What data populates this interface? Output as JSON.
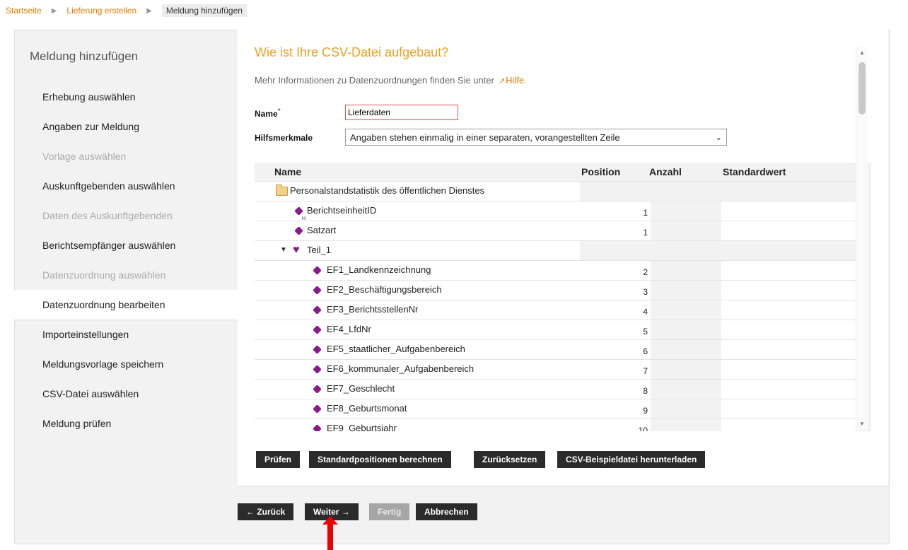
{
  "breadcrumb": {
    "items": [
      "Startseite",
      "Lieferung erstellen"
    ],
    "current": "Meldung hinzufügen"
  },
  "sidebar": {
    "title": "Meldung hinzufügen",
    "steps": [
      {
        "label": "Erhebung auswählen",
        "state": "enabled"
      },
      {
        "label": "Angaben zur Meldung",
        "state": "enabled"
      },
      {
        "label": "Vorlage auswählen",
        "state": "disabled"
      },
      {
        "label": "Auskunftgebenden auswählen",
        "state": "enabled"
      },
      {
        "label": "Daten des Auskunftgebenden",
        "state": "disabled"
      },
      {
        "label": "Berichtsempfänger auswählen",
        "state": "enabled"
      },
      {
        "label": "Datenzuordnung auswählen",
        "state": "disabled"
      },
      {
        "label": "Datenzuordnung bearbeiten",
        "state": "active"
      },
      {
        "label": "Importeinstellungen",
        "state": "enabled"
      },
      {
        "label": "Meldungsvorlage speichern",
        "state": "enabled"
      },
      {
        "label": "CSV-Datei auswählen",
        "state": "enabled"
      },
      {
        "label": "Meldung prüfen",
        "state": "enabled"
      }
    ]
  },
  "main": {
    "title": "Wie ist Ihre CSV-Datei aufgebaut?",
    "info_text": "Mehr Informationen zu Datenzuordnungen finden Sie unter",
    "help_link": "Hilfe.",
    "name_label": "Name",
    "name_required": "*",
    "name_value": "Lieferdaten",
    "hilfsmerkmale_label": "Hilfsmerkmale",
    "hilfsmerkmale_value": "Angaben stehen einmalig in einer separaten, vorangestellten Zeile"
  },
  "table": {
    "headers": {
      "name": "Name",
      "position": "Position",
      "anzahl": "Anzahl",
      "standardwert": "Standardwert"
    },
    "rows": [
      {
        "name": "Personalstandstatistik des öffentlichen Dienstes",
        "position": "",
        "kind": "root",
        "icon": "folder-icon"
      },
      {
        "name": "BerichtseinheitID",
        "position": "1",
        "kind": "leaf-top",
        "icon": "field-icon",
        "badge": "H"
      },
      {
        "name": "Satzart",
        "position": "1",
        "kind": "leaf-top",
        "icon": "field-icon",
        "badge": ""
      },
      {
        "name": "Teil_1",
        "position": "",
        "kind": "group",
        "icon": "group-icon"
      },
      {
        "name": "EF1_Landkennzeichnung",
        "position": "2",
        "kind": "leaf",
        "icon": "field-icon"
      },
      {
        "name": "EF2_Beschäftigungsbereich",
        "position": "3",
        "kind": "leaf",
        "icon": "field-icon"
      },
      {
        "name": "EF3_BerichtsstellenNr",
        "position": "4",
        "kind": "leaf",
        "icon": "field-icon"
      },
      {
        "name": "EF4_LfdNr",
        "position": "5",
        "kind": "leaf",
        "icon": "field-icon"
      },
      {
        "name": "EF5_staatlicher_Aufgabenbereich",
        "position": "6",
        "kind": "leaf",
        "icon": "field-icon"
      },
      {
        "name": "EF6_kommunaler_Aufgabenbereich",
        "position": "7",
        "kind": "leaf",
        "icon": "field-icon"
      },
      {
        "name": "EF7_Geschlecht",
        "position": "8",
        "kind": "leaf",
        "icon": "field-icon"
      },
      {
        "name": "EF8_Geburtsmonat",
        "position": "9",
        "kind": "leaf",
        "icon": "field-icon"
      },
      {
        "name": "EF9_Geburtsjahr",
        "position": "10",
        "kind": "leaf",
        "icon": "field-icon"
      }
    ]
  },
  "actions": {
    "pruefen": "Prüfen",
    "standardpositionen": "Standardpositionen berechnen",
    "zuruecksetzen": "Zurücksetzen",
    "csv_beispiel": "CSV-Beispieldatei herunterladen"
  },
  "nav": {
    "zurueck": "← Zurück",
    "weiter": "Weiter →",
    "fertig": "Fertig",
    "abbrechen": "Abbrechen"
  },
  "colors": {
    "accent": "#e07b00",
    "title": "#f0a020",
    "button": "#2b2b2b",
    "button_disabled": "#a6a6a6",
    "icon": "#8a1a8a",
    "indicator": "#e00000"
  }
}
